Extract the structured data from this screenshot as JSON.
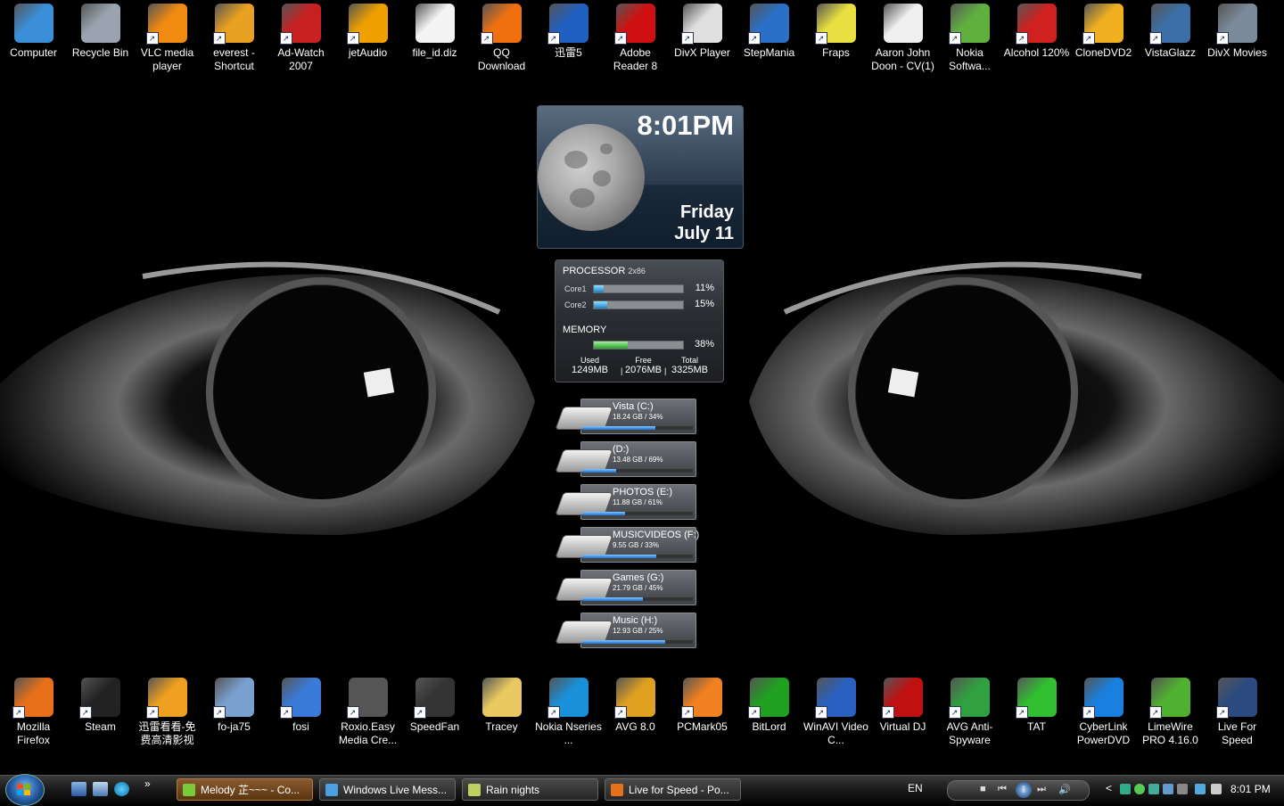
{
  "desktop_icons_top": [
    {
      "label": "Computer",
      "color": "#3a8fd8",
      "shortcut": false
    },
    {
      "label": "Recycle Bin",
      "color": "#9aa4b0",
      "shortcut": false
    },
    {
      "label": "VLC media player",
      "color": "#f08a10",
      "shortcut": true
    },
    {
      "label": "everest - Shortcut",
      "color": "#e8a020",
      "shortcut": true
    },
    {
      "label": "Ad-Watch 2007",
      "color": "#c82020",
      "shortcut": true
    },
    {
      "label": "jetAudio",
      "color": "#f0a000",
      "shortcut": true
    },
    {
      "label": "file_id.diz",
      "color": "#f4f4f4",
      "shortcut": false
    },
    {
      "label": "QQ Download",
      "color": "#f07010",
      "shortcut": true
    },
    {
      "label": "迅雷5",
      "color": "#2060c0",
      "shortcut": true
    },
    {
      "label": "Adobe Reader 8",
      "color": "#d01010",
      "shortcut": true
    },
    {
      "label": "DivX Player",
      "color": "#e0e0e0",
      "shortcut": true
    },
    {
      "label": "StepMania",
      "color": "#2a70c8",
      "shortcut": true
    },
    {
      "label": "Fraps",
      "color": "#e8e040",
      "shortcut": true
    },
    {
      "label": "Aaron John Doon - CV(1)",
      "color": "#f0f0f0",
      "shortcut": false
    },
    {
      "label": "Nokia Softwa...",
      "color": "#60b040",
      "shortcut": true
    },
    {
      "label": "Alcohol 120%",
      "color": "#d02020",
      "shortcut": true
    },
    {
      "label": "CloneDVD2",
      "color": "#f0b020",
      "shortcut": true
    },
    {
      "label": "VistaGlazz",
      "color": "#3c6ea8",
      "shortcut": true
    },
    {
      "label": "DivX Movies",
      "color": "#7a8a9a",
      "shortcut": true
    }
  ],
  "desktop_icons_bottom": [
    {
      "label": "Mozilla Firefox",
      "color": "#e8701a",
      "shortcut": true
    },
    {
      "label": "Steam",
      "color": "#222222",
      "shortcut": true
    },
    {
      "label": "迅雷看看-免费高清影视",
      "color": "#f0a020",
      "shortcut": true
    },
    {
      "label": "fo-ja75",
      "color": "#7aa0d0",
      "shortcut": true
    },
    {
      "label": "fosi",
      "color": "#3a7ad8",
      "shortcut": true
    },
    {
      "label": "Roxio.Easy Media Cre...",
      "color": "#555555",
      "shortcut": true
    },
    {
      "label": "SpeedFan",
      "color": "#333333",
      "shortcut": true
    },
    {
      "label": "Tracey",
      "color": "#e8c860",
      "shortcut": false
    },
    {
      "label": "Nokia Nseries ...",
      "color": "#1a90d8",
      "shortcut": true
    },
    {
      "label": "AVG 8.0",
      "color": "#e0a020",
      "shortcut": true
    },
    {
      "label": "PCMark05",
      "color": "#f08020",
      "shortcut": true
    },
    {
      "label": "BitLord",
      "color": "#20a020",
      "shortcut": true
    },
    {
      "label": "WinAVI Video C...",
      "color": "#2a60c0",
      "shortcut": true
    },
    {
      "label": "Virtual DJ",
      "color": "#c01010",
      "shortcut": true
    },
    {
      "label": "AVG Anti-Spyware",
      "color": "#30a040",
      "shortcut": true
    },
    {
      "label": "TAT",
      "color": "#30c030",
      "shortcut": true
    },
    {
      "label": "CyberLink PowerDVD",
      "color": "#1a80e0",
      "shortcut": true
    },
    {
      "label": "LimeWire PRO 4.16.0",
      "color": "#50b030",
      "shortcut": true
    },
    {
      "label": "Live For Speed",
      "color": "#2a4a80",
      "shortcut": true
    }
  ],
  "clock": {
    "time": "8:01PM",
    "day": "Friday",
    "date": "July 11"
  },
  "processor": {
    "title": "PROCESSOR",
    "cores_label": "2x86",
    "cores": [
      {
        "name": "Core1",
        "pct_text": "11%",
        "value": 0.11
      },
      {
        "name": "Core2",
        "pct_text": "15%",
        "value": 0.15
      }
    ]
  },
  "memory": {
    "title": "MEMORY",
    "pct_text": "38%",
    "value": 0.38,
    "used_label": "Used",
    "used": "1249MB",
    "free_label": "Free",
    "free": "2076MB",
    "total_label": "Total",
    "total": "3325MB",
    "sep": "|"
  },
  "drives": [
    {
      "name": "Vista (C:)",
      "info": "18.24 GB / 34%",
      "value": 0.66
    },
    {
      "name": "(D:)",
      "info": "13.48 GB / 69%",
      "value": 0.31
    },
    {
      "name": "PHOTOS (E:)",
      "info": "11.88 GB / 61%",
      "value": 0.39
    },
    {
      "name": "MUSICVIDEOS (F:)",
      "info": "9.55 GB / 33%",
      "value": 0.67
    },
    {
      "name": "Games (G:)",
      "info": "21.79 GB / 45%",
      "value": 0.55
    },
    {
      "name": "Music (H:)",
      "info": "12.93 GB / 25%",
      "value": 0.75
    }
  ],
  "taskbar": {
    "buttons": [
      {
        "label": "Melody 芷~~~ - Co...",
        "active": true,
        "color": "#7acb3a"
      },
      {
        "label": "Windows Live Mess...",
        "active": false,
        "color": "#4aa0e0"
      },
      {
        "label": "Rain nights",
        "active": false,
        "color": "#c0d060"
      },
      {
        "label": "Live for Speed - Po...",
        "active": false,
        "color": "#e8701a"
      }
    ],
    "quicklaunch_more": "»",
    "language": "EN",
    "clock": "8:01 PM",
    "tray_collapse": "<"
  }
}
